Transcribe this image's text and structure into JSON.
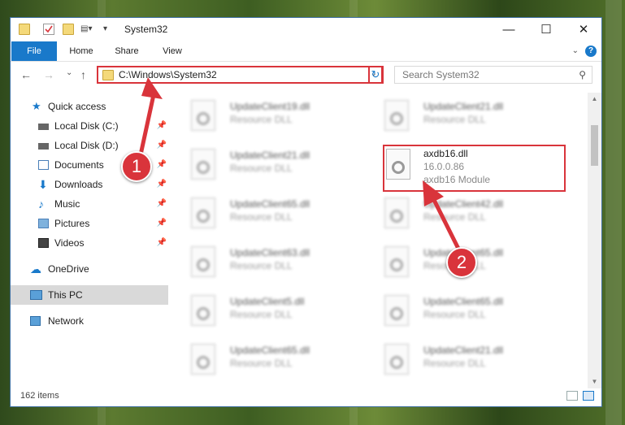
{
  "window": {
    "title": "System32",
    "minimize_glyph": "—",
    "maximize_glyph": "☐",
    "close_glyph": "✕"
  },
  "ribbon": {
    "tabs": [
      "File",
      "Home",
      "Share",
      "View"
    ],
    "help_glyph": "?"
  },
  "navbar": {
    "back_glyph": "←",
    "forward_glyph": "→",
    "recent_glyph": "⌄",
    "up_glyph": "↑",
    "address": "C:\\Windows\\System32",
    "search_placeholder": "Search System32"
  },
  "sidebar": {
    "items": [
      {
        "label": "Quick access",
        "icon": "star-icon",
        "pinned": false
      },
      {
        "label": "Local Disk (C:)",
        "icon": "drive-icon",
        "pinned": true
      },
      {
        "label": "Local Disk (D:)",
        "icon": "drive-icon",
        "pinned": true
      },
      {
        "label": "Documents",
        "icon": "documents-icon",
        "pinned": true
      },
      {
        "label": "Downloads",
        "icon": "download-icon",
        "pinned": true
      },
      {
        "label": "Music",
        "icon": "music-icon",
        "pinned": true
      },
      {
        "label": "Pictures",
        "icon": "pictures-icon",
        "pinned": true
      },
      {
        "label": "Videos",
        "icon": "videos-icon",
        "pinned": true
      },
      {
        "label": "OneDrive",
        "icon": "cloud-icon",
        "pinned": false
      },
      {
        "label": "This PC",
        "icon": "computer-icon",
        "pinned": false,
        "selected": true
      },
      {
        "label": "Network",
        "icon": "network-icon",
        "pinned": false
      }
    ]
  },
  "files": [
    {
      "name": "UpdateClient19.dll",
      "desc": "Resource DLL"
    },
    {
      "name": "UpdateClient21.dll",
      "desc": "Resource DLL"
    },
    {
      "name": "UpdateClient21.dll",
      "desc": "Resource DLL"
    },
    {
      "name": "axdb16.dll",
      "desc": "16.0.0.86",
      "desc2": "axdb16 Module",
      "highlighted": true
    },
    {
      "name": "UpdateClient65.dll",
      "desc": "Resource DLL"
    },
    {
      "name": "UpdateClient42.dll",
      "desc": "Resource DLL"
    },
    {
      "name": "UpdateClient63.dll",
      "desc": "Resource DLL"
    },
    {
      "name": "UpdateClient65.dll",
      "desc": "Resource DLL"
    },
    {
      "name": "UpdateClient5.dll",
      "desc": "Resource DLL"
    },
    {
      "name": "UpdateClient65.dll",
      "desc": "Resource DLL"
    },
    {
      "name": "UpdateClient65.dll",
      "desc": "Resource DLL"
    },
    {
      "name": "UpdateClient21.dll",
      "desc": "Resource DLL"
    }
  ],
  "status": {
    "item_count": "162 items"
  },
  "callouts": [
    "1",
    "2"
  ],
  "colors": {
    "accent": "#1979ca",
    "highlight": "#d9343b"
  }
}
